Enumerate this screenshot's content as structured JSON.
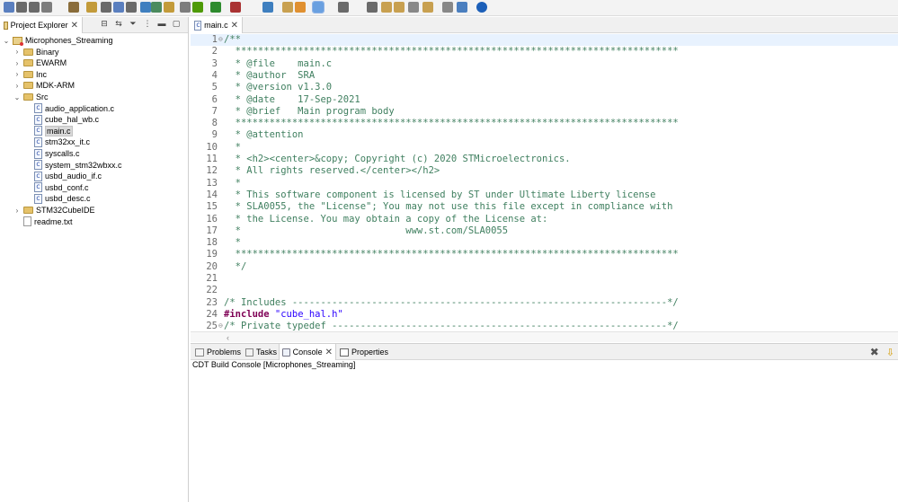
{
  "toolbar": {
    "icons": [
      "new-icon",
      "save-icon",
      "save-all-icon",
      "history-icon",
      "build-icon",
      "project-icon",
      "print-icon",
      "search-icon",
      "settings-icon",
      "new-class-icon",
      "open-type-icon",
      "sync-icon",
      "refresh-icon",
      "debug-icon",
      "run-icon",
      "external-tools-icon",
      "terminal-icon",
      "marker-icon",
      "highlight-icon",
      "toggle-mark-icon",
      "block-select-icon",
      "whitespace-icon",
      "next-annotation-icon",
      "prev-annotation-icon",
      "last-edit-icon",
      "back-icon",
      "forward-icon",
      "perspective-icon",
      "info-icon"
    ]
  },
  "project_explorer": {
    "title": "Project Explorer",
    "tree": [
      {
        "label": "Microphones_Streaming",
        "type": "project",
        "depth": 0,
        "expanded": true
      },
      {
        "label": "Binary",
        "type": "folder",
        "depth": 1
      },
      {
        "label": "EWARM",
        "type": "folder",
        "depth": 1
      },
      {
        "label": "Inc",
        "type": "folder",
        "depth": 1
      },
      {
        "label": "MDK-ARM",
        "type": "folder",
        "depth": 1
      },
      {
        "label": "Src",
        "type": "folder",
        "depth": 1,
        "expanded": true
      },
      {
        "label": "audio_application.c",
        "type": "c",
        "depth": 2
      },
      {
        "label": "cube_hal_wb.c",
        "type": "c",
        "depth": 2
      },
      {
        "label": "main.c",
        "type": "c",
        "depth": 2,
        "selected": true
      },
      {
        "label": "stm32xx_it.c",
        "type": "c",
        "depth": 2
      },
      {
        "label": "syscalls.c",
        "type": "c",
        "depth": 2
      },
      {
        "label": "system_stm32wbxx.c",
        "type": "c",
        "depth": 2
      },
      {
        "label": "usbd_audio_if.c",
        "type": "c",
        "depth": 2
      },
      {
        "label": "usbd_conf.c",
        "type": "c",
        "depth": 2
      },
      {
        "label": "usbd_desc.c",
        "type": "c",
        "depth": 2
      },
      {
        "label": "STM32CubeIDE",
        "type": "folder",
        "depth": 1
      },
      {
        "label": "readme.txt",
        "type": "txt",
        "depth": 1
      }
    ]
  },
  "editor": {
    "tab_label": "main.c",
    "lines": [
      {
        "n": "1",
        "t": "/**",
        "fold": "⊖"
      },
      {
        "n": "2",
        "t": "  ******************************************************************************"
      },
      {
        "n": "3",
        "t": "  * @file    main.c"
      },
      {
        "n": "4",
        "t": "  * @author  SRA"
      },
      {
        "n": "5",
        "t": "  * @version v1.3.0"
      },
      {
        "n": "6",
        "t": "  * @date    17-Sep-2021"
      },
      {
        "n": "7",
        "t": "  * @brief   Main program body"
      },
      {
        "n": "8",
        "t": "  ******************************************************************************"
      },
      {
        "n": "9",
        "t": "  * @attention"
      },
      {
        "n": "10",
        "t": "  *"
      },
      {
        "n": "11",
        "t": "  * <h2><center>&copy; Copyright (c) 2020 STMicroelectronics."
      },
      {
        "n": "12",
        "t": "  * All rights reserved.</center></h2>"
      },
      {
        "n": "13",
        "t": "  *"
      },
      {
        "n": "14",
        "t": "  * This software component is licensed by ST under Ultimate Liberty license"
      },
      {
        "n": "15",
        "t": "  * SLA0055, the \"License\"; You may not use this file except in compliance with"
      },
      {
        "n": "16",
        "t": "  * the License. You may obtain a copy of the License at:"
      },
      {
        "n": "17",
        "t": "  *                             www.st.com/SLA0055"
      },
      {
        "n": "18",
        "t": "  *"
      },
      {
        "n": "19",
        "t": "  ******************************************************************************"
      },
      {
        "n": "20",
        "t": "  */"
      },
      {
        "n": "21",
        "t": ""
      },
      {
        "n": "22",
        "t": ""
      },
      {
        "n": "23",
        "t": "/* Includes ------------------------------------------------------------------*/"
      },
      {
        "n": "24",
        "t": "#include \"cube_hal.h\"",
        "pp": true
      },
      {
        "n": "25",
        "t": "/* Private typedef -----------------------------------------------------------*/",
        "fold": "⊖"
      }
    ]
  },
  "console": {
    "tabs": [
      "Problems",
      "Tasks",
      "Console",
      "Properties"
    ],
    "active_tab": "Console",
    "title": "CDT Build Console [Microphones_Streaming]"
  }
}
